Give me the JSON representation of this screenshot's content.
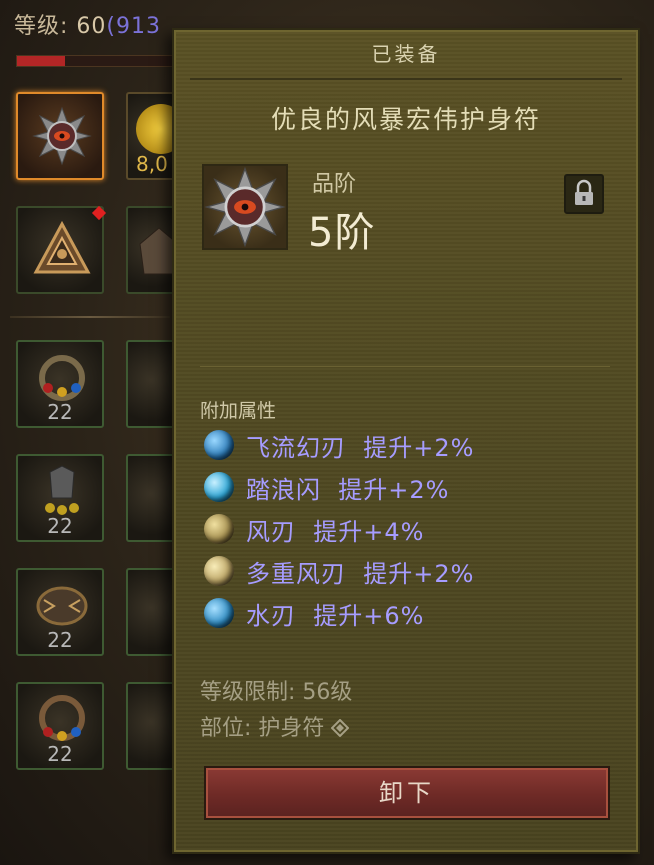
{
  "hud": {
    "level_label": "等级: ",
    "level_value": "60",
    "paragon_value": "(913",
    "xp_progress": 0.3
  },
  "inventory": {
    "gold_amount": "8,0",
    "item_counts": [
      "22",
      "22",
      "22",
      "22"
    ]
  },
  "tooltip": {
    "header": "已装备",
    "item_name": "优良的风暴宏伟护身符",
    "tier_label": "品阶",
    "tier_value": "5阶",
    "lock_icon": "lock-icon",
    "section_title": "附加属性",
    "attributes": [
      {
        "text": "飞流幻刃  提升+2%",
        "icon": "blade-orb-icon",
        "color": "#3a9ad8"
      },
      {
        "text": "踏浪闪  提升+2%",
        "icon": "wave-dash-icon",
        "color": "#3ab8e0"
      },
      {
        "text": "风刃  提升+4%",
        "icon": "wind-blade-icon",
        "color": "#b8a86a"
      },
      {
        "text": "多重风刃  提升+2%",
        "icon": "multi-wind-blade-icon",
        "color": "#c8b87a"
      },
      {
        "text": "水刃  提升+6%",
        "icon": "water-blade-icon",
        "color": "#3a9ad0"
      }
    ],
    "level_requirement": "等级限制: 56级",
    "slot_type": "部位: 护身符",
    "unequip_label": "卸下"
  },
  "colors": {
    "attribute_text": "#a69cff",
    "selected_border": "#e08a2a"
  }
}
